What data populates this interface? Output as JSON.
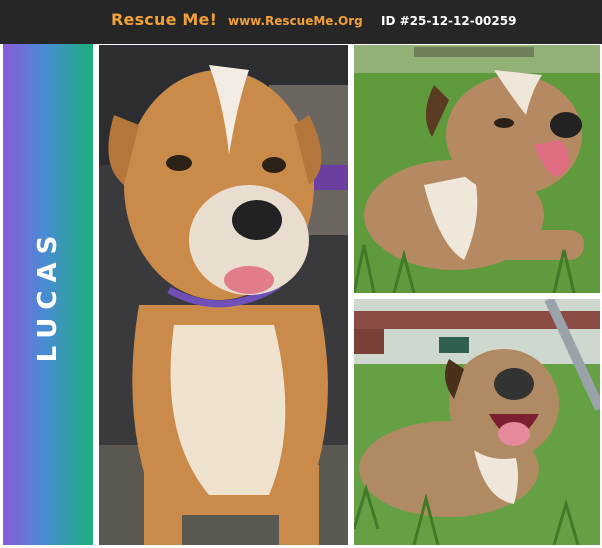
{
  "header": {
    "brand": "Rescue Me!",
    "website": "www.RescueMe.Org",
    "pet_id": "ID #25-12-12-00259"
  },
  "pet": {
    "name": "LUCAS"
  },
  "colors": {
    "header_bg": "#262626",
    "accent": "#f0a03a",
    "gradient": [
      "#8a5bd8",
      "#4a8bd6",
      "#1ab07a"
    ]
  },
  "photos": [
    {
      "subject": "dog-sitting-in-car"
    },
    {
      "subject": "dog-lying-in-grass"
    },
    {
      "subject": "dog-lying-in-grass-yard"
    }
  ]
}
